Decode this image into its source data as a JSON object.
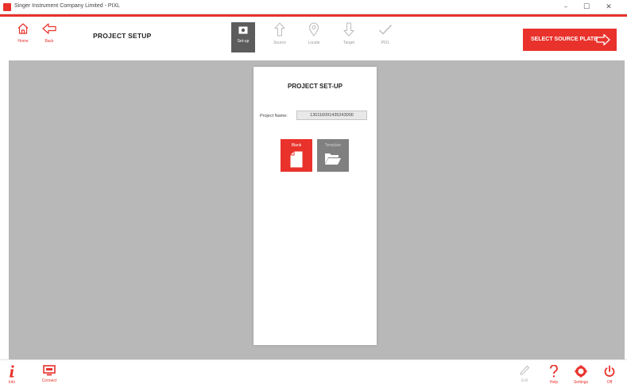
{
  "colors": {
    "accent": "#e8322b",
    "workspace": "#b8b8b8",
    "active_step": "#5c5c5c",
    "template_tile": "#808080",
    "disabled": "#bbbbbb"
  },
  "window": {
    "title": "Singer Instrument Company Limited - PIXL",
    "controls": {
      "minimize": "–",
      "maximize": "☐",
      "close": "✕"
    }
  },
  "toolbar": {
    "home_label": "Home",
    "back_label": "Back",
    "page_title": "PROJECT SETUP",
    "steps": [
      {
        "label": "Set-up",
        "icon": "camera-icon",
        "active": true
      },
      {
        "label": "Source",
        "icon": "arrow-up-icon",
        "active": false
      },
      {
        "label": "Locate",
        "icon": "location-pin-icon",
        "active": false
      },
      {
        "label": "Target",
        "icon": "arrow-down-icon",
        "active": false
      },
      {
        "label": "PIXL",
        "icon": "checkmark-icon",
        "active": false
      }
    ],
    "next_label": "SELECT SOURCE PLATE"
  },
  "card": {
    "title": "PROJECT SET-UP",
    "project_name_label": "Project Name:",
    "project_name_value": "130116091435243000",
    "blank_label": "Blank",
    "template_label": "Template"
  },
  "footer": {
    "info_label": "Info",
    "connect_label": "Connect",
    "edit_label": "Edit",
    "help_label": "Help",
    "settings_label": "Settings",
    "off_label": "Off"
  }
}
